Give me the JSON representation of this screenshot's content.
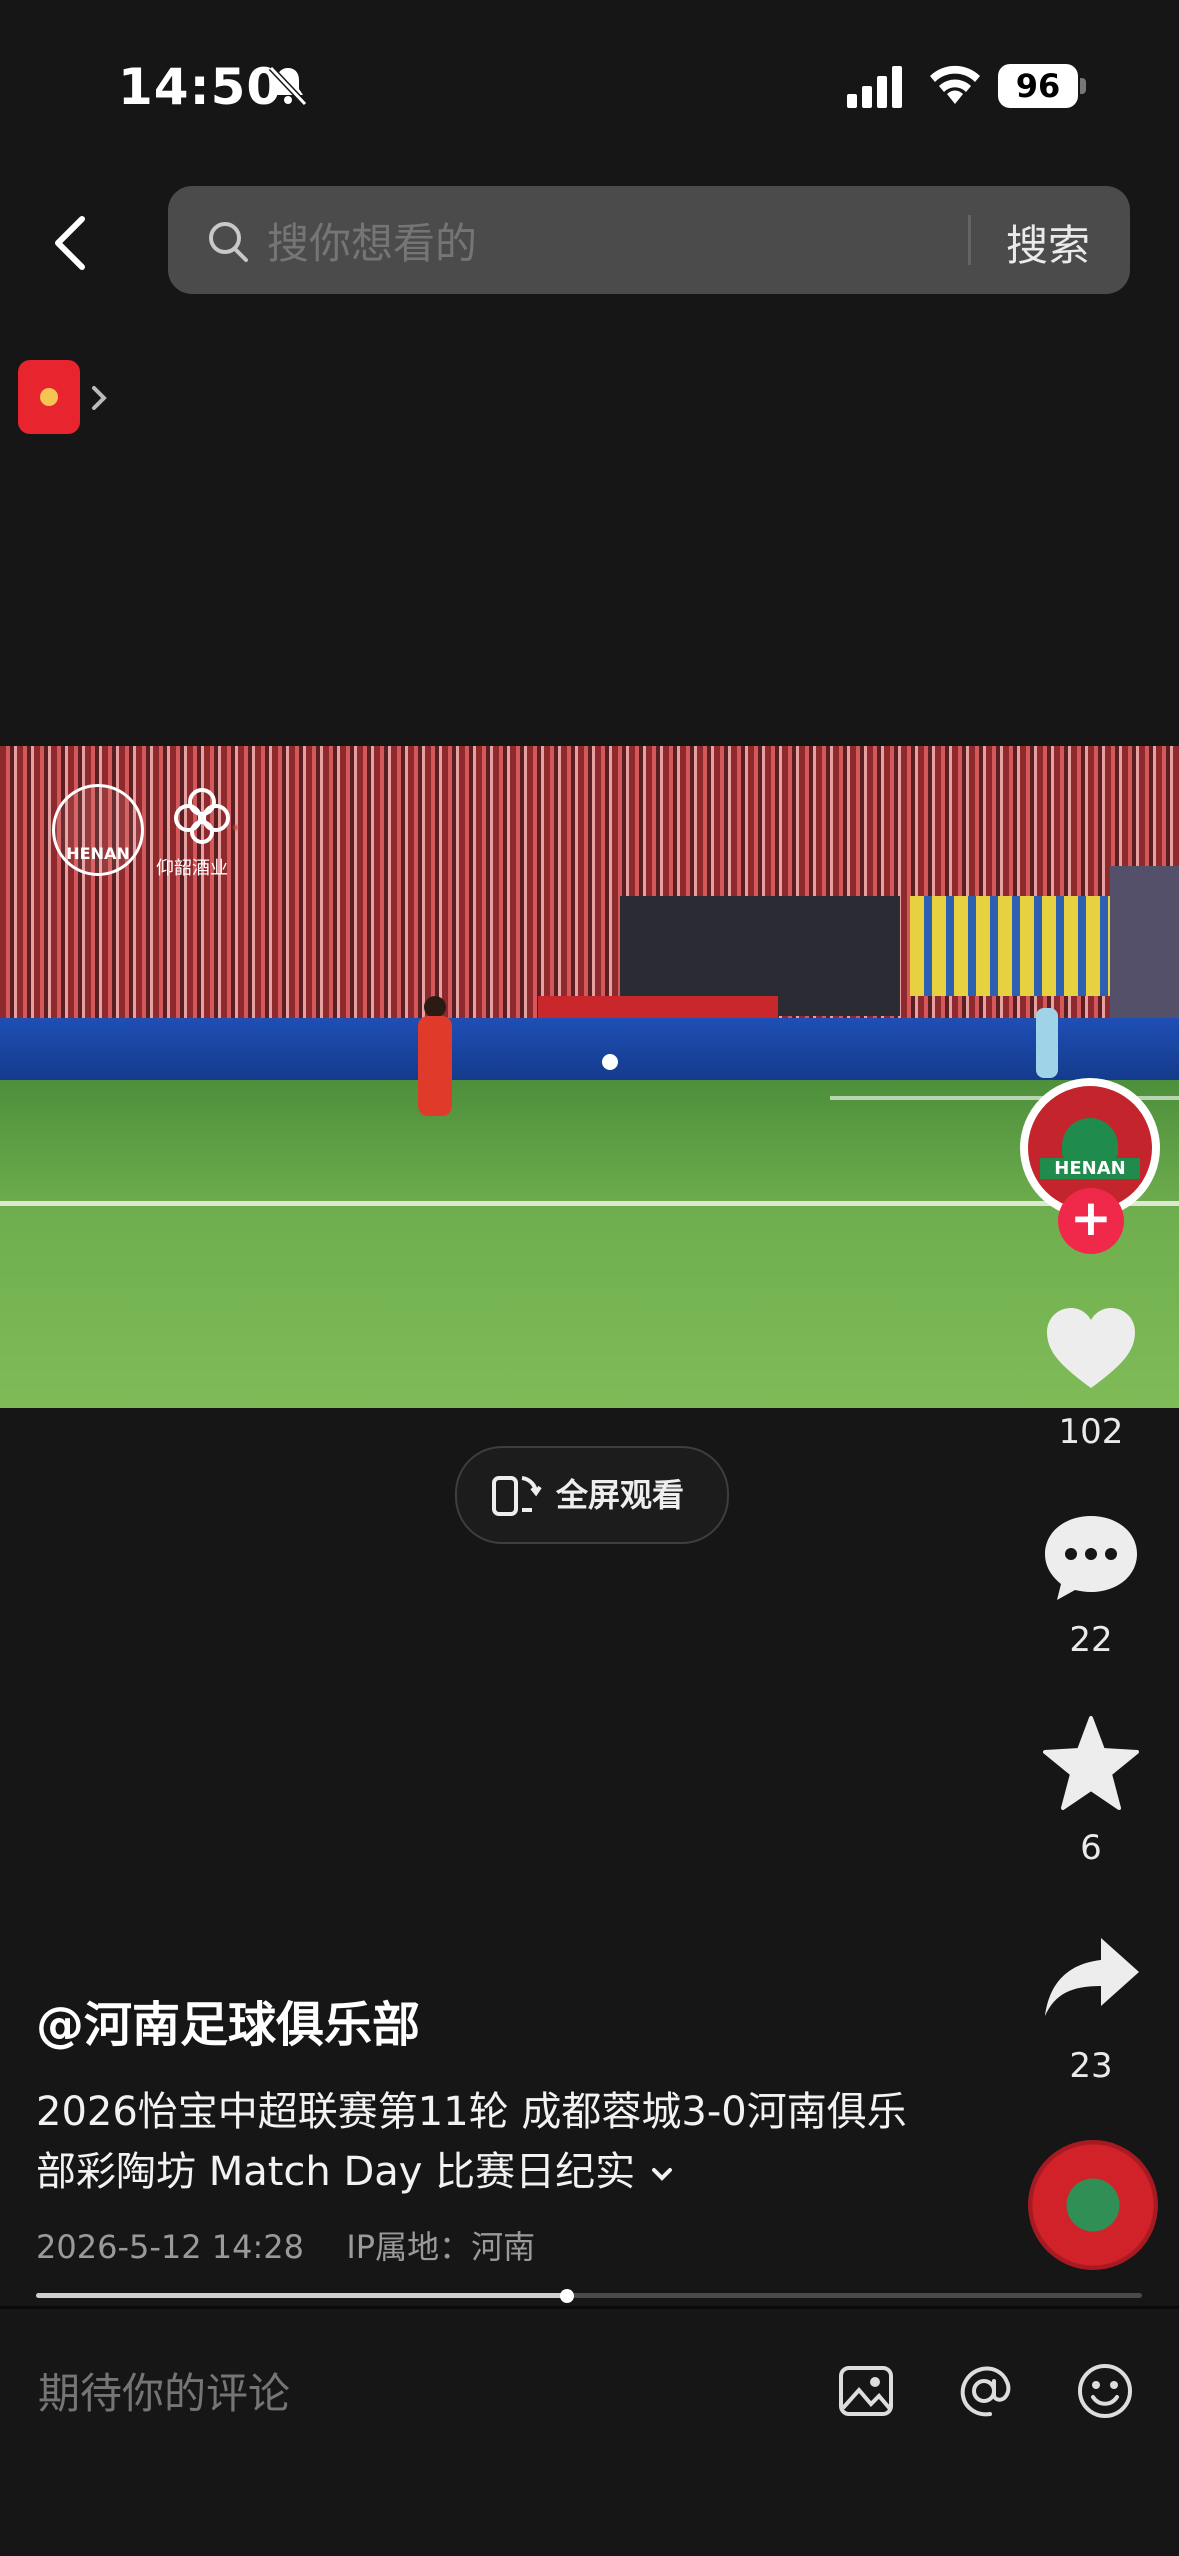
{
  "status_bar": {
    "time": "14:50",
    "battery": "96"
  },
  "search": {
    "placeholder": "搜你想看的",
    "button": "搜索"
  },
  "video": {
    "overlay_logo_text": "HENAN",
    "sponsor_text": "仰韶酒业"
  },
  "fullscreen": {
    "label": "全屏观看"
  },
  "creator": {
    "badge_text": "HENAN"
  },
  "actions": {
    "likes": "102",
    "comments": "22",
    "favorites": "6",
    "shares": "23"
  },
  "post": {
    "author": "@河南足球俱乐部",
    "description": "2026怡宝中超联赛第11轮 成都蓉城3-0河南俱乐部彩陶坊 Match Day 比赛日纪实",
    "date": "2026-5-12 14:28",
    "ip_location": "IP属地：河南"
  },
  "playback": {
    "progress": 0.48
  },
  "comment_bar": {
    "placeholder": "期待你的评论"
  },
  "icons": {
    "status": [
      "bell-muted-icon",
      "signal-icon",
      "wifi-icon",
      "battery-icon"
    ],
    "rail": [
      "heart-icon",
      "comment-bubble-icon",
      "star-icon",
      "share-arrow-icon"
    ],
    "comment_bar": [
      "image-icon",
      "at-icon",
      "emoji-icon"
    ]
  },
  "colors": {
    "background": "#161616",
    "accent": "#f0284a",
    "search_bg": "#4b4b4b"
  }
}
